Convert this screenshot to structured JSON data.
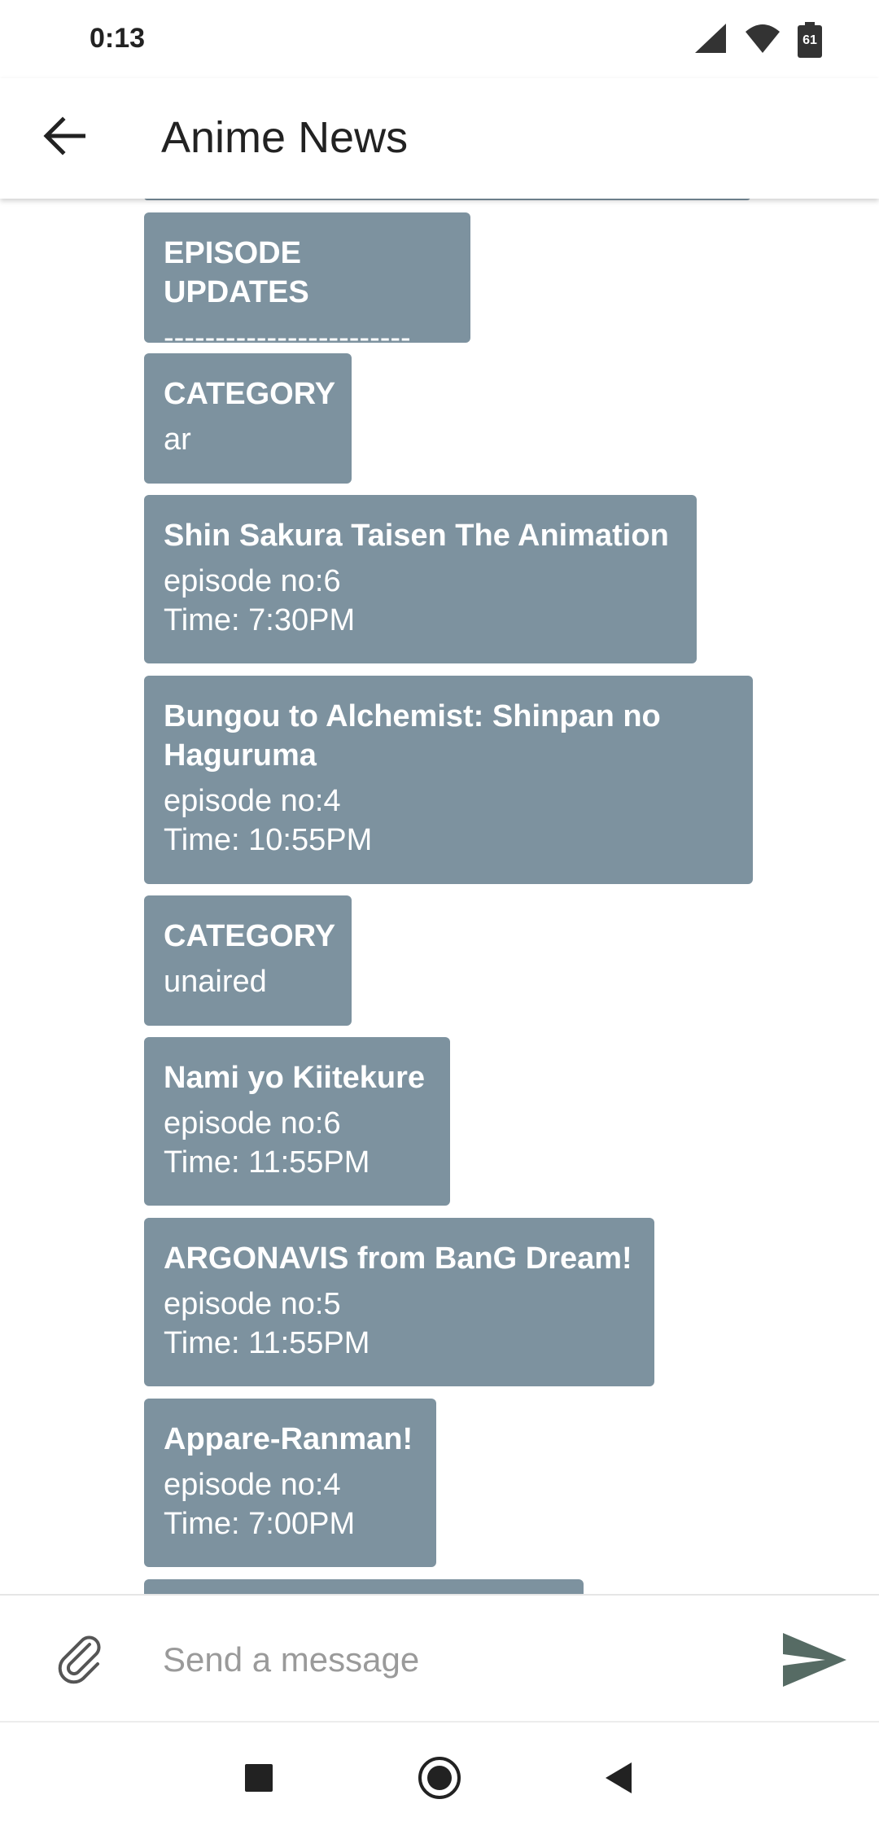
{
  "status_bar": {
    "time": "0:13",
    "battery_level": "61",
    "icons": [
      "signal-icon",
      "wifi-icon",
      "battery-icon"
    ]
  },
  "app_bar": {
    "title": "Anime News",
    "back_icon": "back-arrow-icon"
  },
  "messages": [
    {
      "title": "EPISODE UPDATES",
      "body": "------------------------"
    },
    {
      "title": "CATEGORY",
      "body": "ar"
    },
    {
      "title": "Shin Sakura Taisen The Animation",
      "body": "episode no:6\n Time: 7:30PM"
    },
    {
      "title": "Bungou to Alchemist: Shinpan no Haguruma",
      "body": "episode no:4\nTime: 10:55PM"
    },
    {
      "title": "CATEGORY",
      "body": "unaired"
    },
    {
      "title": "Nami yo Kiitekure",
      "body": "episode no:6\nTime: 11:55PM"
    },
    {
      "title": "ARGONAVIS from BanG Dream!",
      "body": "episode no:5\nTime: 11:55PM"
    },
    {
      "title": "Appare-Ranman!",
      "body": "episode no:4\nTime: 7:00PM"
    }
  ],
  "composer": {
    "placeholder": "Send a message",
    "attach_icon": "paperclip-icon",
    "send_icon": "send-icon"
  },
  "colors": {
    "bubble": "#7d929f",
    "bubble_text": "#ffffff",
    "send_icon": "#566b64"
  }
}
